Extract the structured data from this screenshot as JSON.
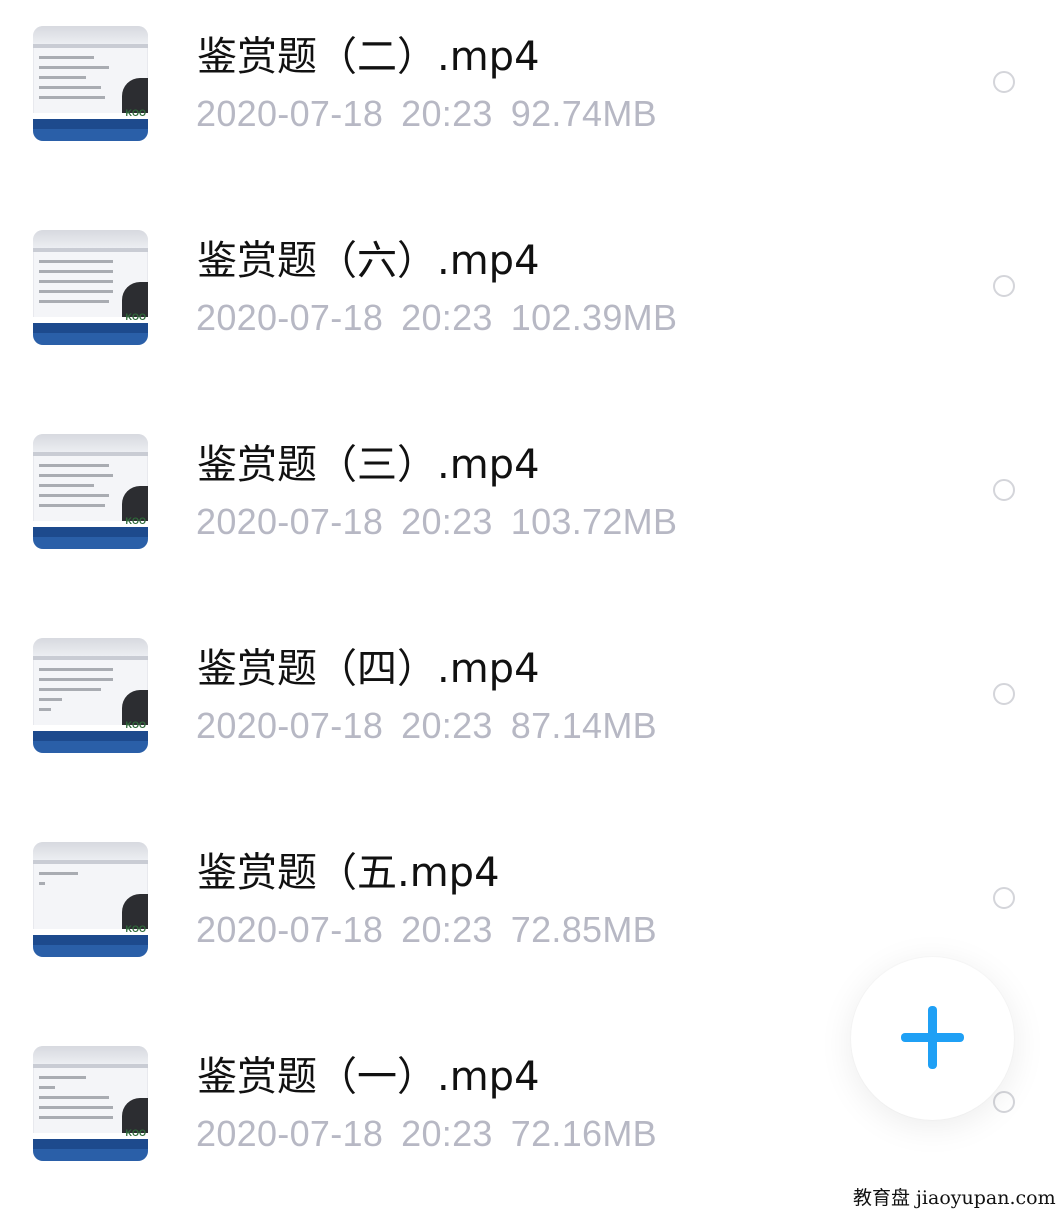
{
  "files": [
    {
      "name": "鉴赏题（二）.mp4",
      "date": "2020-07-18",
      "time": "20:23",
      "size": "92.74MB"
    },
    {
      "name": "鉴赏题（六）.mp4",
      "date": "2020-07-18",
      "time": "20:23",
      "size": "102.39MB"
    },
    {
      "name": "鉴赏题（三）.mp4",
      "date": "2020-07-18",
      "time": "20:23",
      "size": "103.72MB"
    },
    {
      "name": "鉴赏题（四）.mp4",
      "date": "2020-07-18",
      "time": "20:23",
      "size": "87.14MB"
    },
    {
      "name": "鉴赏题（五.mp4",
      "date": "2020-07-18",
      "time": "20:23",
      "size": "72.85MB"
    },
    {
      "name": "鉴赏题（一）.mp4",
      "date": "2020-07-18",
      "time": "20:23",
      "size": "72.16MB"
    }
  ],
  "thumbnail_logo": "KOO",
  "fab": {
    "icon": "plus-icon",
    "color": "#1fa0f5"
  },
  "watermark": "教育盘 jiaoyupan.com"
}
